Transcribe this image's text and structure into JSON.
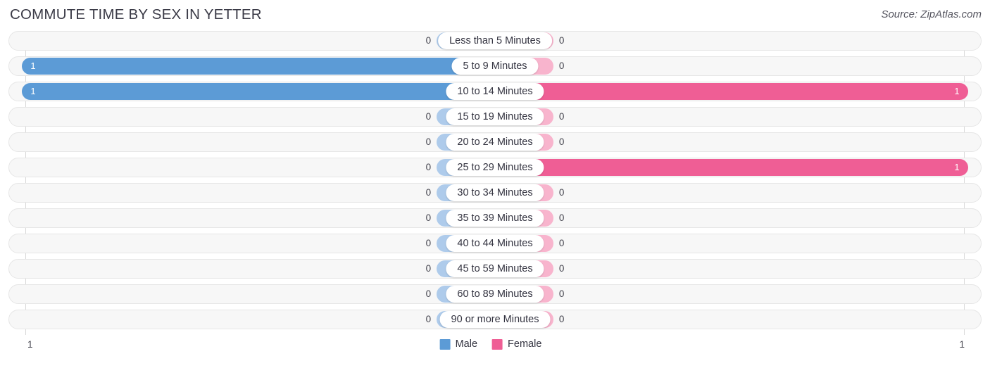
{
  "header": {
    "title": "COMMUTE TIME BY SEX IN YETTER",
    "source": "Source: ZipAtlas.com"
  },
  "legend": {
    "items": [
      {
        "label": "Male",
        "color": "#5c9bd6"
      },
      {
        "label": "Female",
        "color": "#ef5e95"
      }
    ]
  },
  "axis": {
    "left_tick": "1",
    "right_tick": "1"
  },
  "chart_data": {
    "type": "bar",
    "orientation": "horizontal-diverging",
    "title": "COMMUTE TIME BY SEX IN YETTER",
    "xlabel": "",
    "ylabel": "",
    "xlim": [
      1,
      0,
      1
    ],
    "grid": false,
    "legend_position": "bottom-center",
    "categories": [
      "Less than 5 Minutes",
      "5 to 9 Minutes",
      "10 to 14 Minutes",
      "15 to 19 Minutes",
      "20 to 24 Minutes",
      "25 to 29 Minutes",
      "30 to 34 Minutes",
      "35 to 39 Minutes",
      "40 to 44 Minutes",
      "45 to 59 Minutes",
      "60 to 89 Minutes",
      "90 or more Minutes"
    ],
    "series": [
      {
        "name": "Male",
        "values": [
          0,
          1,
          1,
          0,
          0,
          0,
          0,
          0,
          0,
          0,
          0,
          0
        ]
      },
      {
        "name": "Female",
        "values": [
          0,
          0,
          1,
          0,
          0,
          1,
          0,
          0,
          0,
          0,
          0,
          0
        ]
      }
    ],
    "value_labels": {
      "Male": [
        "0",
        "1",
        "1",
        "0",
        "0",
        "0",
        "0",
        "0",
        "0",
        "0",
        "0",
        "0"
      ],
      "Female": [
        "0",
        "0",
        "1",
        "0",
        "0",
        "1",
        "0",
        "0",
        "0",
        "0",
        "0",
        "0"
      ]
    },
    "colors": {
      "male_filled": "#5c9bd6",
      "male_empty": "#aecbeb",
      "female_filled": "#ef5e95",
      "female_empty": "#f8b4cd"
    }
  }
}
